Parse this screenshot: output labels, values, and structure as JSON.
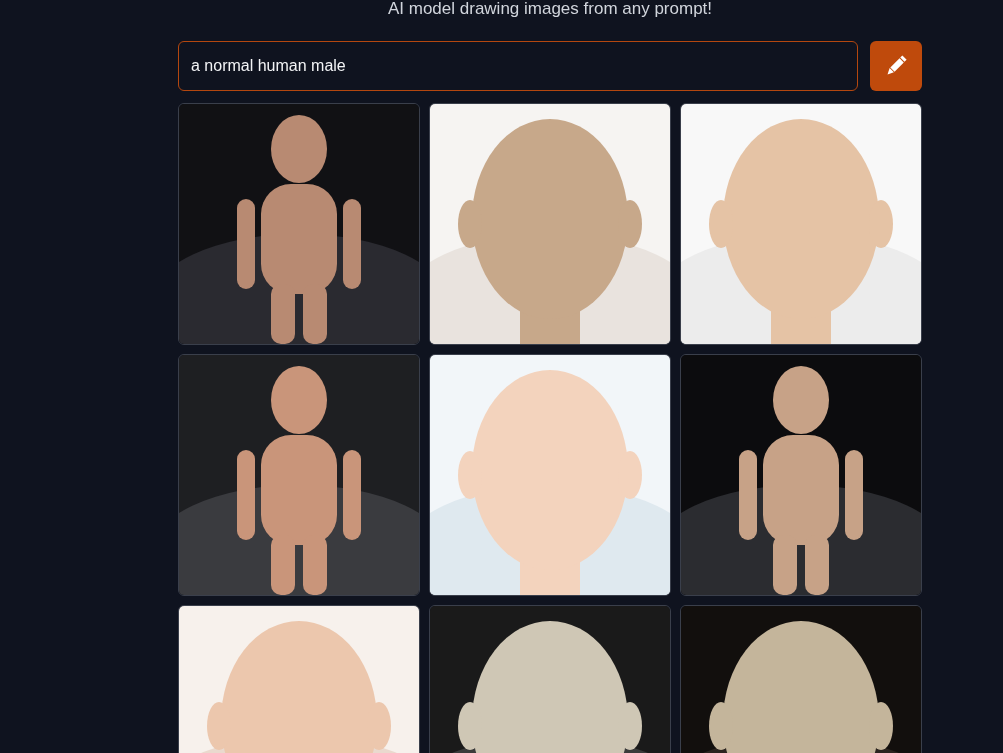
{
  "header": {
    "subtitle": "AI model drawing images from any prompt!"
  },
  "prompt": {
    "value": "a normal human male"
  }
}
